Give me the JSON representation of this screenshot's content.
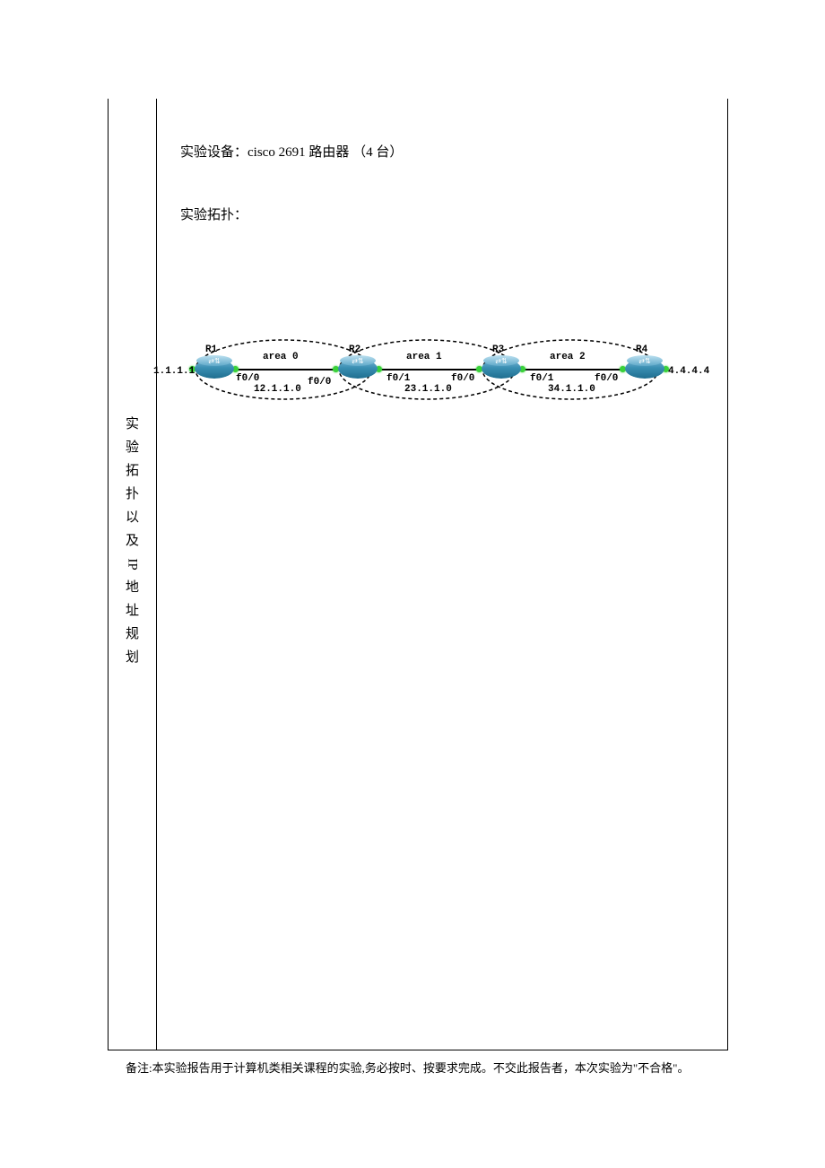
{
  "sideTitle": [
    "实",
    "验",
    "拓",
    "扑",
    "以",
    "及",
    "IP",
    "地",
    "址",
    "规",
    "划"
  ],
  "equipLabel": "实验设备：",
  "equipValue": "cisco 2691 路由器 （4 台）",
  "topoLabel": "实验拓扑：",
  "footer": "备注:本实验报告用于计算机类相关课程的实验,务必按时、按要求完成。不交此报告者，本次实验为\"不合格\"。",
  "diagram": {
    "routers": [
      {
        "name": "R1",
        "loopback": "1.1.1.1"
      },
      {
        "name": "R2"
      },
      {
        "name": "R3"
      },
      {
        "name": "R4",
        "loopback": "4.4.4.4"
      }
    ],
    "areas": [
      {
        "name": "area 0"
      },
      {
        "name": "area 1"
      },
      {
        "name": "area 2"
      }
    ],
    "links": [
      {
        "left_if": "f0/0",
        "right_if": "f0/0",
        "network": "12.1.1.0"
      },
      {
        "left_if": "f0/1",
        "right_if": "f0/0",
        "network": "23.1.1.0"
      },
      {
        "left_if": "f0/1",
        "right_if": "f0/0",
        "network": "34.1.1.0"
      }
    ]
  }
}
